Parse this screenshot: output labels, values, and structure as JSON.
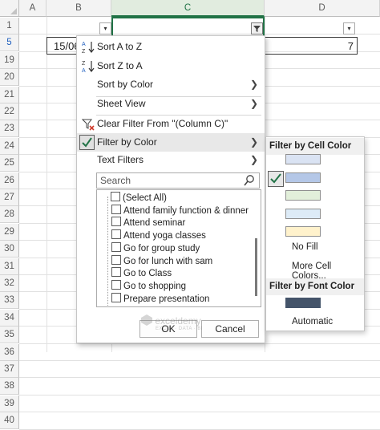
{
  "sheet": {
    "columns": [
      "A",
      "B",
      "C",
      "D"
    ],
    "rows": [
      "1",
      "5",
      "19",
      "20",
      "21",
      "22",
      "23",
      "24",
      "25",
      "26",
      "27",
      "28",
      "29",
      "30",
      "31",
      "32",
      "33",
      "34",
      "35",
      "36",
      "37",
      "38",
      "39",
      "40"
    ],
    "cell_b5": "15/06",
    "cell_d5": "7",
    "filter_glyph": "▾"
  },
  "menu": {
    "sort_az": "Sort A to Z",
    "sort_za": "Sort Z to A",
    "sort_by_color": "Sort by Color",
    "sheet_view": "Sheet View",
    "clear_filter": "Clear Filter From \"(Column C)\"",
    "filter_by_color": "Filter by Color",
    "text_filters": "Text Filters",
    "search_placeholder": "Search",
    "items": [
      "(Select All)",
      "Attend family function & dinner",
      "Attend seminar",
      "Attend yoga classes",
      "Go for group study",
      "Go for lunch with sam",
      "Go to Class",
      "Go to shopping",
      "Prepare presentation"
    ],
    "ok": "OK",
    "cancel": "Cancel"
  },
  "submenu": {
    "cell_color_header": "Filter by Cell Color",
    "cell_colors": [
      "#dae3f3",
      "#b4c7e7",
      "#e2efda",
      "#ddebf7",
      "#fff2cc"
    ],
    "no_fill": "No Fill",
    "more_colors": "More Cell Colors...",
    "font_color_header": "Filter by Font Color",
    "font_color": "#44546a",
    "automatic": "Automatic"
  },
  "watermark": {
    "name": "exceldemy",
    "tagline": "EXCEL · DATA · BI"
  }
}
